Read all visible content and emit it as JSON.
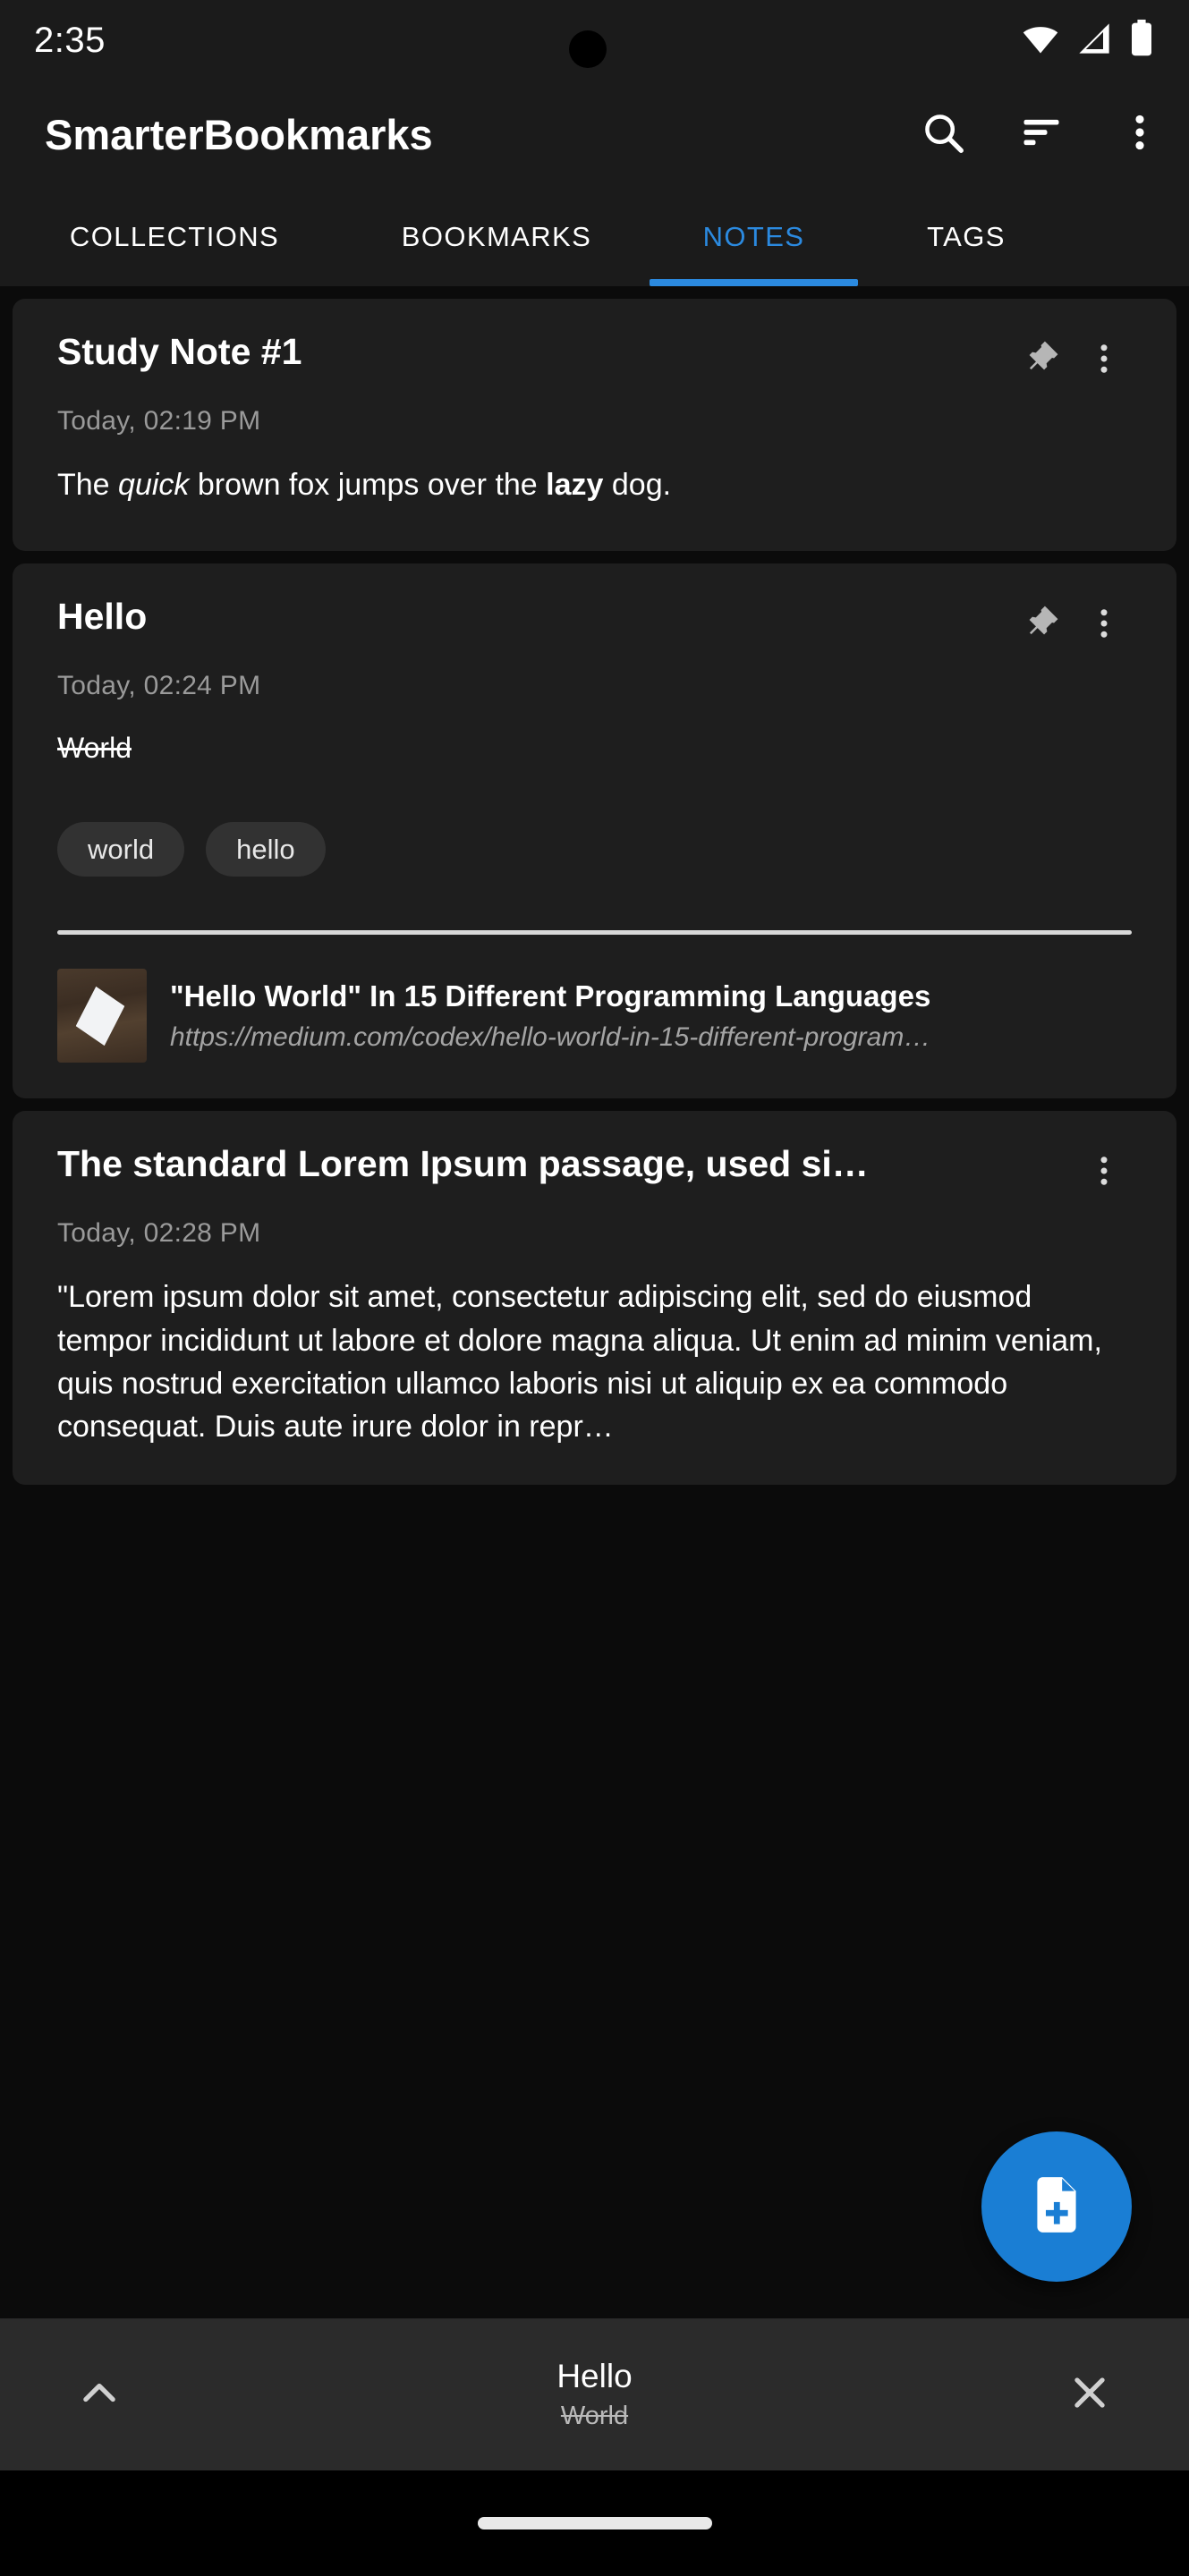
{
  "status_bar": {
    "time": "2:35",
    "icons": [
      "wifi-icon",
      "cellular-signal-icon",
      "battery-icon"
    ]
  },
  "app_bar": {
    "title": "SmarterBookmarks",
    "actions": [
      {
        "name": "search-icon",
        "label": "Search"
      },
      {
        "name": "sort-icon",
        "label": "Sort"
      },
      {
        "name": "overflow-menu-icon",
        "label": "More options"
      }
    ]
  },
  "tabs": {
    "items": [
      {
        "label": "COLLECTIONS",
        "active": false
      },
      {
        "label": "BOOKMARKS",
        "active": false
      },
      {
        "label": "NOTES",
        "active": true
      },
      {
        "label": "TAGS",
        "active": false
      }
    ],
    "active_index": 2,
    "indicator_color": "#2b8ae0"
  },
  "notes": [
    {
      "title": "Study Note #1",
      "date": "Today, 02:19 PM",
      "body_plain": "The quick brown fox jumps over the lazy dog.",
      "body_parts": [
        {
          "text": "The ",
          "style": "normal"
        },
        {
          "text": "quick",
          "style": "italic"
        },
        {
          "text": " brown fox jumps over the ",
          "style": "normal"
        },
        {
          "text": "lazy",
          "style": "bold"
        },
        {
          "text": " dog.",
          "style": "normal"
        }
      ],
      "pin_icon": "pushpin-icon",
      "menu_icon": "overflow-menu-icon"
    },
    {
      "title": "Hello",
      "date": "Today, 02:24 PM",
      "body_plain": "World",
      "body_style": "strikethrough",
      "pin_icon": "pushpin-icon",
      "menu_icon": "overflow-menu-icon",
      "tags": [
        "world",
        "hello"
      ],
      "bookmark": {
        "title": "\"Hello World\" In 15 Different Programming Languages",
        "url": "https://medium.com/codex/hello-world-in-15-different-program…",
        "thumbnail": "article-thumbnail"
      }
    },
    {
      "title": "The standard Lorem Ipsum passage, used si…",
      "date": "Today, 02:28 PM",
      "body_plain": "\"Lorem ipsum dolor sit amet, consectetur adipiscing elit, sed do eiusmod tempor incididunt ut labore et dolore magna aliqua. Ut enim ad minim veniam, quis nostrud exercitation ullamco laboris nisi ut aliquip ex ea commodo consequat. Duis aute irure dolor in repr…",
      "menu_icon": "overflow-menu-icon"
    }
  ],
  "fab": {
    "name": "add-note-fab",
    "icon": "note-add-icon",
    "color": "#1a7ed4"
  },
  "bottom_bar": {
    "expand_icon": "chevron-up-icon",
    "title": "Hello",
    "subtitle": "World",
    "close_icon": "close-icon"
  },
  "nav_bar": {
    "handle": "gesture-pill"
  },
  "colors": {
    "background": "#0b0b0b",
    "surface": "#1e1e1e",
    "appbar": "#1b1b1b",
    "accent": "#2b8ae0",
    "text_primary": "#ffffff",
    "text_secondary": "#9a9a9a"
  }
}
